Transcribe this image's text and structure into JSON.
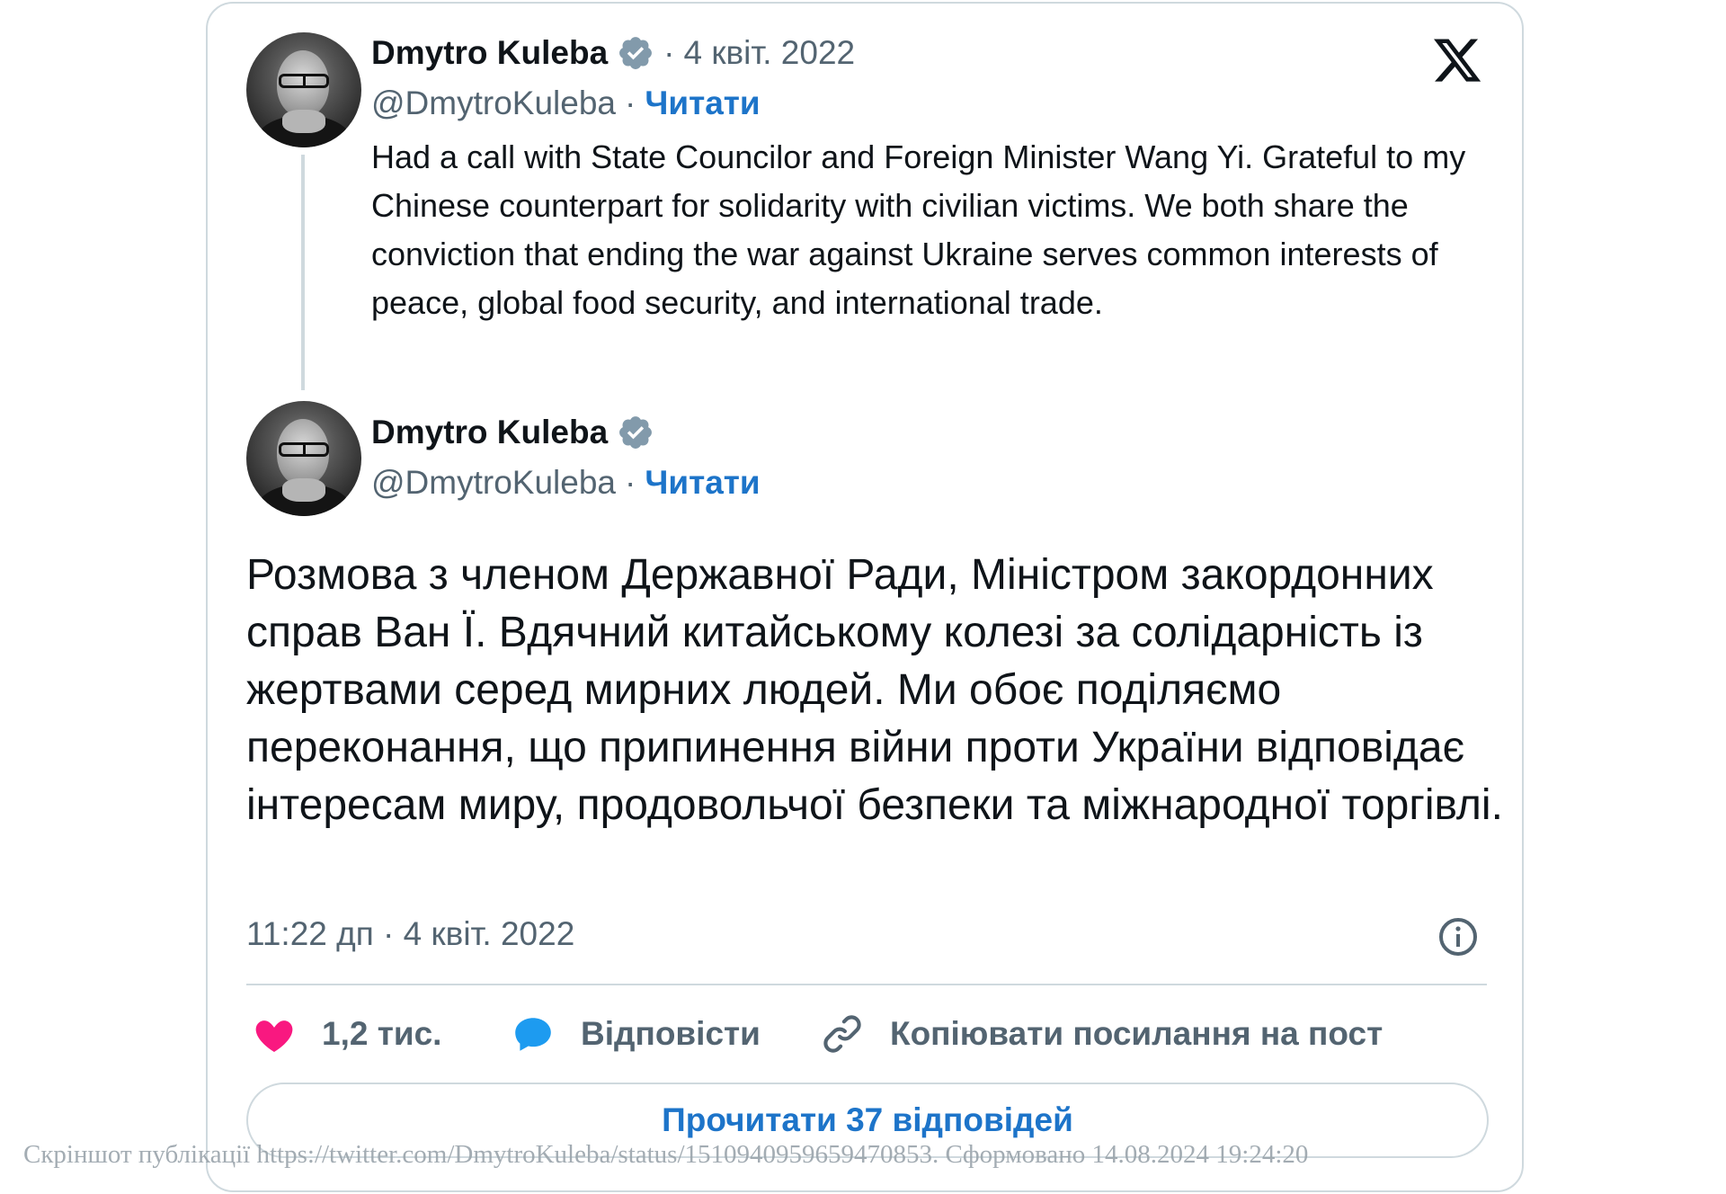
{
  "quoted_tweet": {
    "author_name": "Dmytro Kuleba",
    "author_handle": "@DmytroKuleba",
    "separator": "·",
    "date": "4 квіт. 2022",
    "follow_label": "Читати",
    "text": "Had a call with State Councilor and Foreign Minister Wang Yi. Grateful to my Chinese counterpart for solidarity with civilian victims. We both share the conviction that ending the war against Ukraine serves common interests of peace, global food security, and international trade."
  },
  "main_tweet": {
    "author_name": "Dmytro Kuleba",
    "author_handle": "@DmytroKuleba",
    "separator": "·",
    "follow_label": "Читати",
    "text": "Розмова з членом Державної Ради, Міністром закордонних справ Ван Ї. Вдячний китайському колезі за солідарність із жертвами серед мирних людей. Ми обоє поділяємо переконання, що припинення війни проти України відповідає інтересам миру, продовольчої безпеки та міжнародної торгівлі.",
    "timestamp": "11:22 дп · 4 квіт. 2022"
  },
  "actions": {
    "likes_count": "1,2 тис.",
    "reply_label": "Відповісти",
    "copy_link_label": "Копіювати посилання на пост",
    "read_replies_label": "Прочитати 37 відповідей"
  },
  "icons": {
    "logo": "x-logo-icon",
    "verified": "verified-badge-icon",
    "info": "info-icon",
    "like": "heart-icon",
    "reply": "speech-bubble-icon",
    "copy_link": "link-icon"
  },
  "colors": {
    "accent": "#1d74c9",
    "like": "#f91880",
    "reply": "#1d9bf0",
    "muted": "#536471",
    "border": "#cfd9de",
    "verified": "#829aab"
  },
  "watermark": "Скріншот публікації https://twitter.com/DmytroKuleba/status/1510940959659470853. Сформовано 14.08.2024 19:24:20"
}
